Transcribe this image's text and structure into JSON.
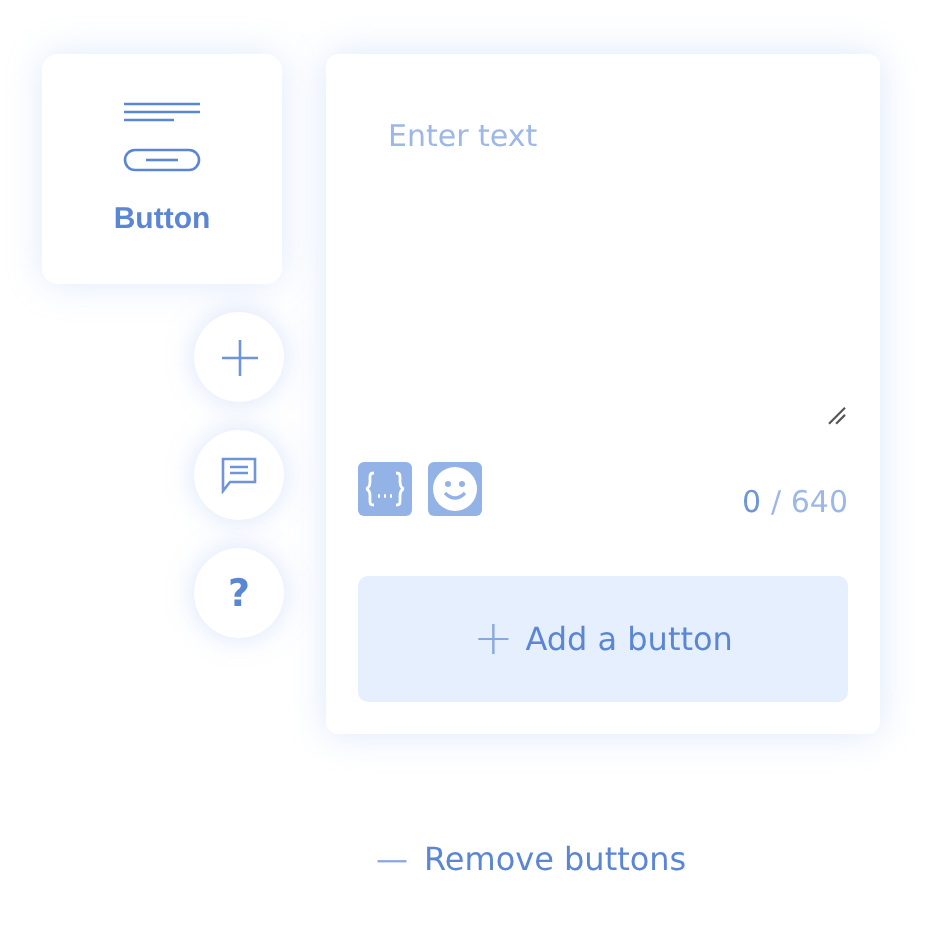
{
  "widget_card": {
    "label": "Button",
    "selected": false
  },
  "side_actions": [
    {
      "kind": "add"
    },
    {
      "kind": "comment"
    },
    {
      "kind": "help",
      "symbol": "?"
    }
  ],
  "editor": {
    "placeholder": "Enter text",
    "count": "0",
    "limit": "/ 640"
  },
  "add_button": {
    "icon": "+",
    "label": "Add a button"
  },
  "remove_link": {
    "icon": "—",
    "label": "Remove buttons"
  }
}
